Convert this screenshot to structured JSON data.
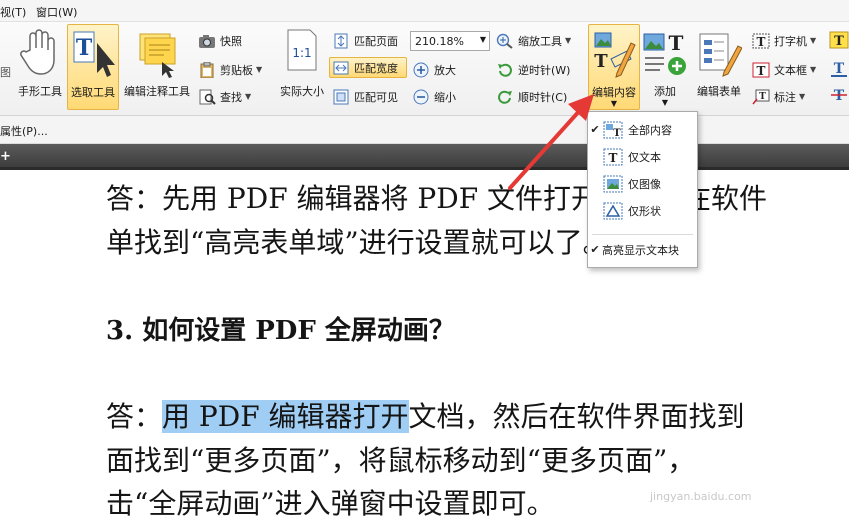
{
  "menubar": {
    "item_partial": "视(T)",
    "window": "窗口(W)"
  },
  "ribbon": {
    "left_partial": "图",
    "hand_tool": "手形工具",
    "select_tool": "选取工具",
    "annot_tool": "编辑注释工具",
    "snapshot": "快照",
    "clipboard": "剪贴板",
    "find": "查找",
    "actual_size": "实际大小",
    "fit_page": "匹配页面",
    "fit_width": "匹配宽度",
    "fit_visible": "匹配可见",
    "zoom_value": "210.18%",
    "zoom_tool": "缩放工具",
    "zoom_in": "放大",
    "zoom_out": "缩小",
    "rotate_ccw": "逆时针(W)",
    "rotate_cw": "顺时针(C)",
    "edit_content": "编辑内容",
    "add": "添加",
    "edit_form": "编辑表单",
    "typewriter": "打字机",
    "textbox": "文本框",
    "callout": "标注"
  },
  "tabstrip": {
    "properties": "属性(P)..."
  },
  "dropdown": {
    "items": [
      {
        "label": "全部内容",
        "checked": true
      },
      {
        "label": "仅文本",
        "checked": false
      },
      {
        "label": "仅图像",
        "checked": false
      },
      {
        "label": "仅形状",
        "checked": false
      }
    ],
    "highlight": {
      "label": "高亮显示文本块",
      "checked": true
    }
  },
  "document": {
    "answer1_line1": "答：先用 PDF 编辑器将 PDF 文件打开，然后在软件",
    "answer1_line2": "单找到“高亮表单域”进行设置就可以了。",
    "heading3": "3.  如何设置 PDF 全屏动画？",
    "answer3_prefix": "答：",
    "answer3_selected": "用 PDF 编辑器打开",
    "answer3_rest": "文档，然后在软件界面找到",
    "answer3_line2": "面找到“更多页面”，将鼠标移动到“更多页面”，",
    "answer3_line3": "击“全屏动画”进入弹窗中设置即可。"
  },
  "watermark": "jingyan.baidu.com",
  "colors": {
    "accent_highlight": "#ffd975",
    "selection": "#9fcdf3",
    "arrow": "#e53935"
  }
}
